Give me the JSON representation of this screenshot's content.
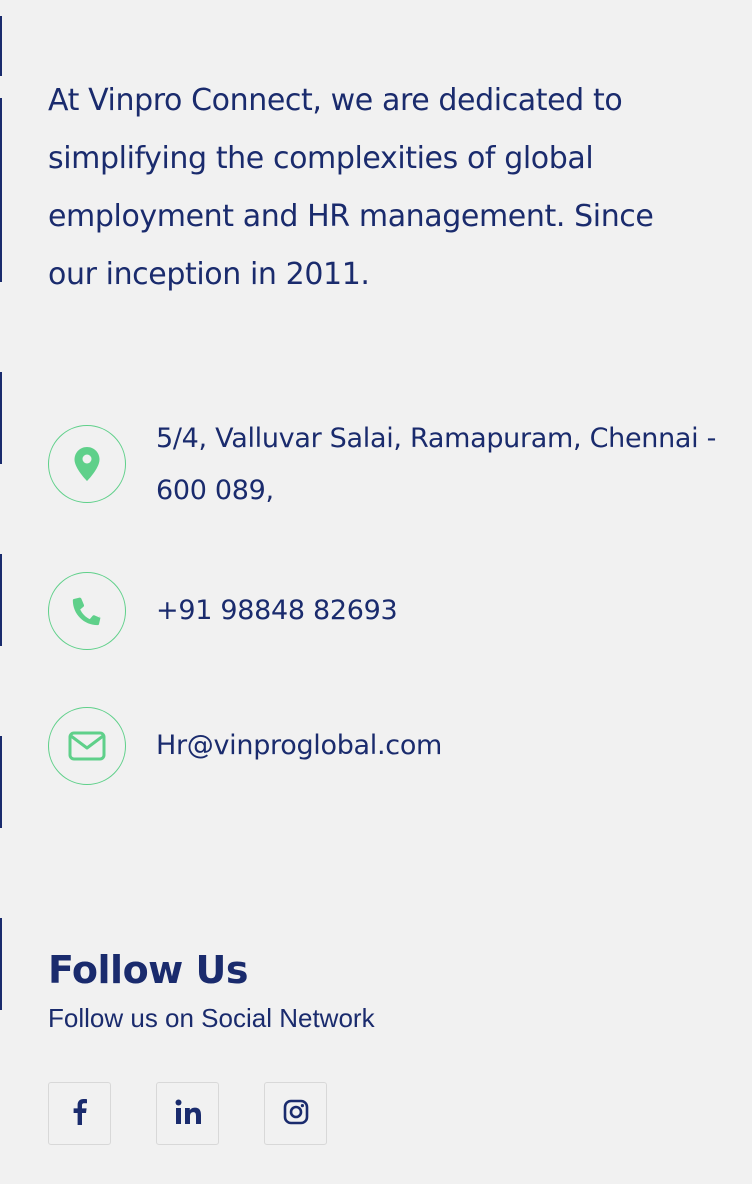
{
  "about": {
    "text": "At Vinpro Connect, we are dedicated to simplifying the complexities of global employment and HR management. Since our inception in 2011."
  },
  "contact": {
    "address": "5/4, Valluvar Salai, Ramapuram, Chennai - 600 089,",
    "phone": "+91 98848 82693",
    "email": "Hr@vinproglobal.com"
  },
  "follow": {
    "title": "Follow Us",
    "subtitle": "Follow us on Social Network"
  },
  "social": [
    {
      "name": "facebook-icon"
    },
    {
      "name": "linkedin-icon"
    },
    {
      "name": "instagram-icon"
    }
  ],
  "colors": {
    "text": "#1a2b6d",
    "accent": "#5fd08a",
    "background": "#f1f1f1"
  }
}
